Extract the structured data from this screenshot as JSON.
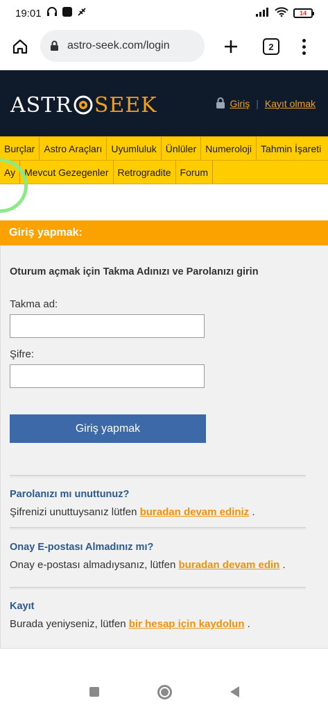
{
  "status": {
    "time": "19:01",
    "battery": "14"
  },
  "browser": {
    "url": "astro-seek.com/login",
    "tab_count": "2"
  },
  "header": {
    "logo_left": "ASTR",
    "logo_right": "SEEK",
    "login_link": "Giriş",
    "register_link": "Kayıt olmak",
    "separator": "|"
  },
  "nav": {
    "row1": [
      "Burçlar",
      "Astro Araçları",
      "Uyumluluk",
      "Ünlüler",
      "Numeroloji",
      "Tahmin İşareti"
    ],
    "row2": [
      "Ay",
      "Mevcut Gezegenler",
      "Retrogradite",
      "Forum"
    ]
  },
  "login": {
    "panel_title": "Giriş yapmak:",
    "intro": "Oturum açmak için Takma Adınızı ve Parolanızı girin",
    "username_label": "Takma ad:",
    "password_label": "Şifre:",
    "submit": "Giriş yapmak"
  },
  "sections": {
    "forgot_title": "Parolanızı mı unuttunuz?",
    "forgot_text": "Şifrenizi unuttuysanız lütfen ",
    "forgot_link": "buradan devam ediniz",
    "forgot_end": " .",
    "confirm_title": "Onay E-postası Almadınız mı?",
    "confirm_text": "Onay e-postası almadıysanız, lütfen ",
    "confirm_link": "buradan devam edin",
    "confirm_end": " .",
    "register_title": "Kayıt",
    "register_text": "Burada yeniyseniz, lütfen ",
    "register_link": "bir hesap için kaydolun",
    "register_end": " ."
  },
  "colors": {
    "header_bg": "#0f1b2b",
    "accent": "#f2a11d",
    "nav_bg": "#ffcc00",
    "panel_title_bg": "#fca200",
    "button_bg": "#3e69a8",
    "section_title": "#2c5a8f"
  },
  "icons": [
    "headphones-icon",
    "notification-app-icon",
    "signal-icon",
    "wifi-icon",
    "battery-icon",
    "home-icon",
    "lock-icon",
    "plus-icon",
    "tabs-icon",
    "more-vert-icon"
  ]
}
